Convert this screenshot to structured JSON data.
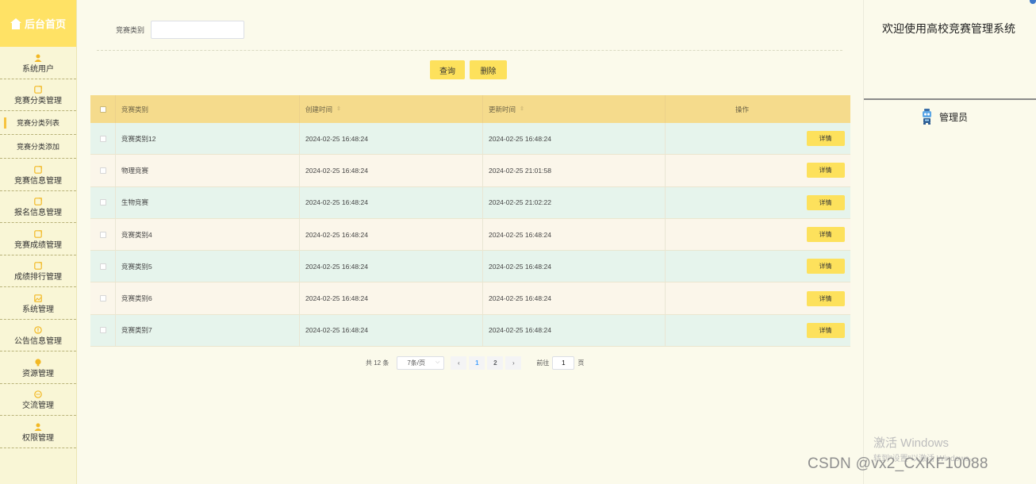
{
  "sidebar": {
    "brand": "后台首页",
    "items": [
      {
        "label": "系统用户",
        "icon": "user-icon"
      },
      {
        "label": "竞赛分类管理",
        "icon": "folder-icon"
      },
      {
        "label": "竞赛分类列表",
        "sub": true
      },
      {
        "label": "竞赛分类添加",
        "sub": true
      },
      {
        "label": "竞赛信息管理",
        "icon": "folder-icon"
      },
      {
        "label": "报名信息管理",
        "icon": "folder-icon"
      },
      {
        "label": "竞赛成绩管理",
        "icon": "folder-icon"
      },
      {
        "label": "成绩排行管理",
        "icon": "folder-icon"
      },
      {
        "label": "系统管理",
        "icon": "image-icon"
      },
      {
        "label": "公告信息管理",
        "icon": "info-icon"
      },
      {
        "label": "资源管理",
        "icon": "bulb-icon"
      },
      {
        "label": "交流管理",
        "icon": "chat-icon"
      },
      {
        "label": "权限管理",
        "icon": "user-icon"
      }
    ]
  },
  "filter": {
    "label": "竞赛类别",
    "value": ""
  },
  "buttons": {
    "query": "查询",
    "delete": "删除"
  },
  "table": {
    "headers": [
      "竞赛类别",
      "创建时间",
      "更新时间",
      "操作"
    ],
    "detail_label": "详情",
    "rows": [
      {
        "name": "竞赛类别12",
        "created": "2024-02-25 16:48:24",
        "updated": "2024-02-25 16:48:24"
      },
      {
        "name": "物理竞赛",
        "created": "2024-02-25 16:48:24",
        "updated": "2024-02-25 21:01:58"
      },
      {
        "name": "生物竞赛",
        "created": "2024-02-25 16:48:24",
        "updated": "2024-02-25 21:02:22"
      },
      {
        "name": "竞赛类别4",
        "created": "2024-02-25 16:48:24",
        "updated": "2024-02-25 16:48:24"
      },
      {
        "name": "竞赛类别5",
        "created": "2024-02-25 16:48:24",
        "updated": "2024-02-25 16:48:24"
      },
      {
        "name": "竞赛类别6",
        "created": "2024-02-25 16:48:24",
        "updated": "2024-02-25 16:48:24"
      },
      {
        "name": "竞赛类别7",
        "created": "2024-02-25 16:48:24",
        "updated": "2024-02-25 16:48:24"
      }
    ]
  },
  "pagination": {
    "total": "共 12 条",
    "page_size": "7条/页",
    "pages": [
      "1",
      "2"
    ],
    "current": "1",
    "goto_prefix": "前往",
    "goto_value": "1",
    "goto_suffix": "页"
  },
  "right_panel": {
    "welcome": "欢迎使用高校竞赛管理系统",
    "user": "管理员"
  },
  "overlay": {
    "activate_title": "激活 Windows",
    "activate_sub": "转到\"设置\"以激活 Windows。",
    "csdn": "CSDN @vx2_CXKF10088"
  },
  "colors": {
    "accent": "#fde15c",
    "sidebar": "#f9f6d6",
    "header": "#f5db8c",
    "row_alt": "#e6f4ec"
  }
}
